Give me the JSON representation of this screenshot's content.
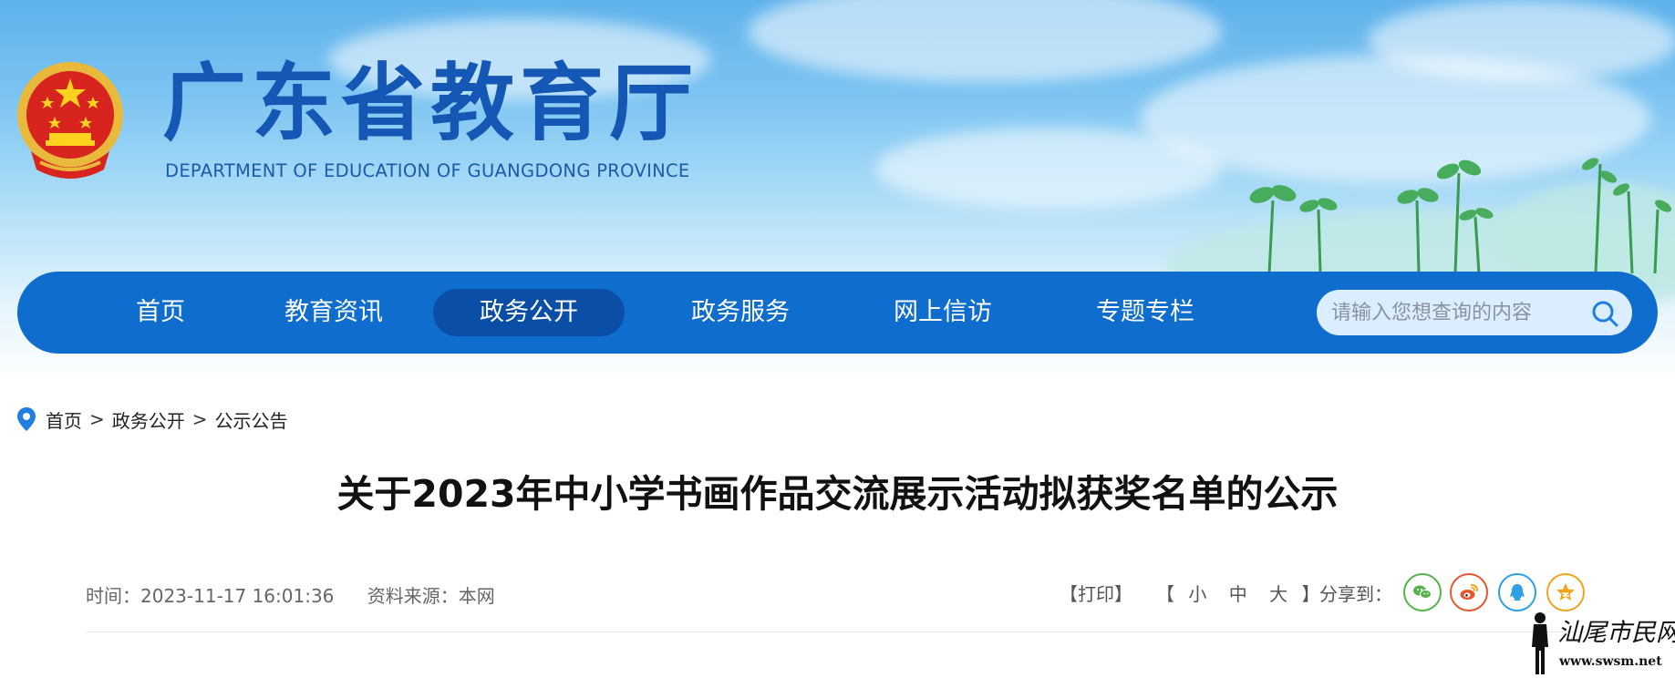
{
  "site": {
    "title": "广东省教育厅",
    "subtitle": "DEPARTMENT OF EDUCATION OF GUANGDONG PROVINCE"
  },
  "nav": {
    "items": [
      {
        "label": "首页",
        "active": false
      },
      {
        "label": "教育资讯",
        "active": false
      },
      {
        "label": "政务公开",
        "active": true
      },
      {
        "label": "政务服务",
        "active": false
      },
      {
        "label": "网上信访",
        "active": false
      },
      {
        "label": "专题专栏",
        "active": false
      }
    ],
    "search_placeholder": "请输入您想查询的内容"
  },
  "breadcrumb": {
    "items": [
      "首页",
      "政务公开",
      "公示公告"
    ],
    "separator": ">"
  },
  "article": {
    "title": "关于2023年中小学书画作品交流展示活动拟获奖名单的公示",
    "time": "时间：2023-11-17 16:01:36",
    "source": "资料来源：本网"
  },
  "tools": {
    "print": "【打印】",
    "size_open": "【",
    "size_small": "小",
    "size_medium": "中",
    "size_large": "大",
    "size_close": "】",
    "share_label": "分享到：",
    "share_icons": [
      {
        "name": "wechat-icon",
        "color": "#56b34b"
      },
      {
        "name": "weibo-icon",
        "color": "#e8562e"
      },
      {
        "name": "qq-icon",
        "color": "#2f9fe6"
      },
      {
        "name": "qzone-icon",
        "color": "#f2a41c"
      }
    ]
  },
  "watermark": {
    "text": "汕尾市民网",
    "url": "www.swsm.net"
  },
  "colors": {
    "nav_bg": "#0e6dcd",
    "nav_active": "#0a4ea6",
    "title_blue": "#1557b4"
  }
}
